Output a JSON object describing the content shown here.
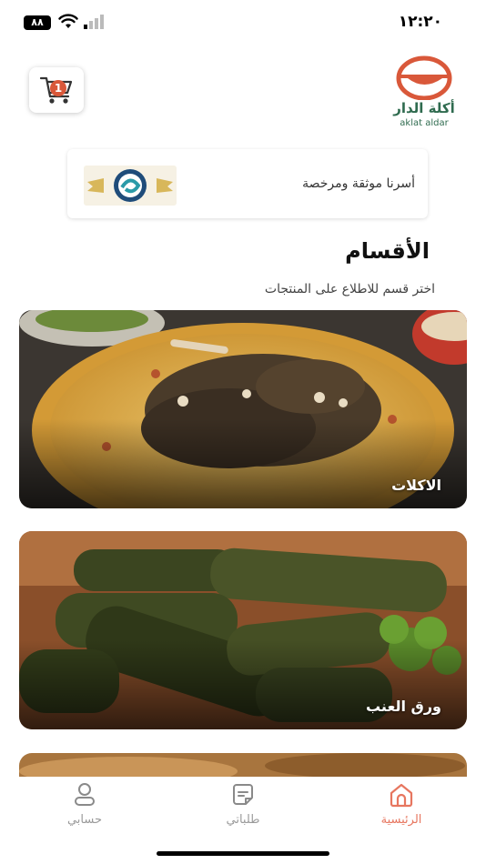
{
  "status_bar": {
    "time": "١٢:٢٠",
    "battery": "٨٨"
  },
  "header": {
    "cart_count": "1",
    "logo_ar": "أكلة الدار",
    "logo_en": "aklat aldar"
  },
  "trust_banner": {
    "text": "أسرنا موثقة ومرخصة"
  },
  "categories_section": {
    "title": "الأقسام",
    "subtitle": "اختر قسم للاطلاع على المنتجات",
    "items": [
      {
        "label": "الاكلات"
      },
      {
        "label": "ورق العنب"
      },
      {
        "label": ""
      }
    ]
  },
  "bottom_nav": {
    "items": [
      {
        "label": "حسابي"
      },
      {
        "label": "طلباتي"
      },
      {
        "label": "الرئيسية"
      }
    ],
    "active_color": "#e7765f",
    "inactive_color": "#9a9a9a"
  },
  "colors": {
    "brand": "#d9583a",
    "brand_green": "#2f6b4f"
  }
}
